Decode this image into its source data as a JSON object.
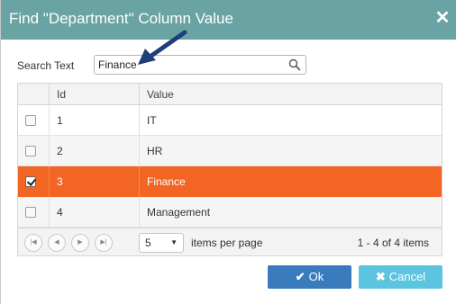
{
  "dialog": {
    "title": "Find \"Department\" Column Value",
    "close_glyph": "✕"
  },
  "search": {
    "label": "Search Text",
    "value": "Finance",
    "icon": "search-icon"
  },
  "grid": {
    "columns": [
      "",
      "Id",
      "Value"
    ],
    "rows": [
      {
        "checked": false,
        "selected": false,
        "id": "1",
        "value": "IT"
      },
      {
        "checked": false,
        "selected": false,
        "id": "2",
        "value": "HR"
      },
      {
        "checked": true,
        "selected": true,
        "id": "3",
        "value": "Finance"
      },
      {
        "checked": false,
        "selected": false,
        "id": "4",
        "value": "Management"
      }
    ],
    "selected_row_color": "#f26522"
  },
  "pager": {
    "page_size": "5",
    "items_per_page_label": "items per page",
    "info": "1 - 4 of 4 items"
  },
  "buttons": {
    "ok_label": "Ok",
    "cancel_label": "Cancel",
    "ok_color": "#3a7bbd",
    "cancel_color": "#5bc4e0"
  },
  "colors": {
    "titlebar": "#6aa3a3"
  }
}
